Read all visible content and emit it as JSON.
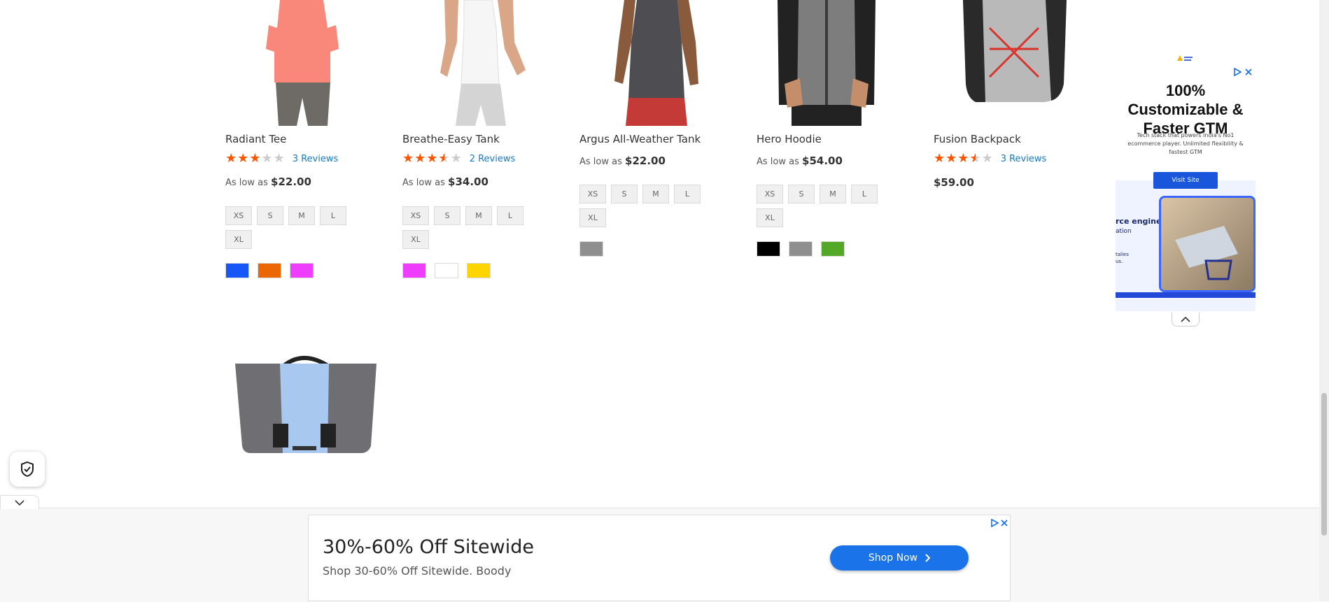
{
  "products": [
    {
      "name": "Radiant Tee",
      "stars": 3,
      "reviews": "3 Reviews",
      "price_prefix": "As low as",
      "price": "$22.00",
      "sizes": [
        "XS",
        "S",
        "M",
        "L",
        "XL"
      ],
      "colors": [
        "#1857f7",
        "#eb6703",
        "#ef3dff"
      ]
    },
    {
      "name": "Breathe-Easy Tank",
      "stars": 3.5,
      "reviews": "2 Reviews",
      "price_prefix": "As low as",
      "price": "$34.00",
      "sizes": [
        "XS",
        "S",
        "M",
        "L",
        "XL"
      ],
      "colors": [
        "#ef3dff",
        "#ffffff",
        "#ffd500"
      ]
    },
    {
      "name": "Argus All-Weather Tank",
      "price_prefix": "As low as",
      "price": "$22.00",
      "sizes": [
        "XS",
        "S",
        "M",
        "L",
        "XL"
      ],
      "colors": [
        "#8f8f8f"
      ]
    },
    {
      "name": "Hero Hoodie",
      "price_prefix": "As low as",
      "price": "$54.00",
      "sizes": [
        "XS",
        "S",
        "M",
        "L",
        "XL"
      ],
      "colors": [
        "#000000",
        "#8f8f8f",
        "#53a828"
      ]
    },
    {
      "name": "Fusion Backpack",
      "stars": 3.5,
      "reviews": "3 Reviews",
      "price": "$59.00"
    }
  ],
  "side_ad": {
    "headline": "100% Customizable & Faster GTM",
    "body": "Tech stack that powers India's No1 ecommerce player. Unlimited flexibility & fastest GTM",
    "cta": "Visit Site",
    "image_text_1": "rce engine",
    "image_text_2": "ation",
    "image_text_3": "talies",
    "image_text_4": "us."
  },
  "bottom_ad": {
    "headline": "30%-60% Off Sitewide",
    "subtext": "Shop 30-60% Off Sitewide. Boody",
    "cta": "Shop Now"
  },
  "colors": {
    "accent": "#1979c3",
    "star": "#ff5501",
    "ad_button": "#1a73e8"
  }
}
